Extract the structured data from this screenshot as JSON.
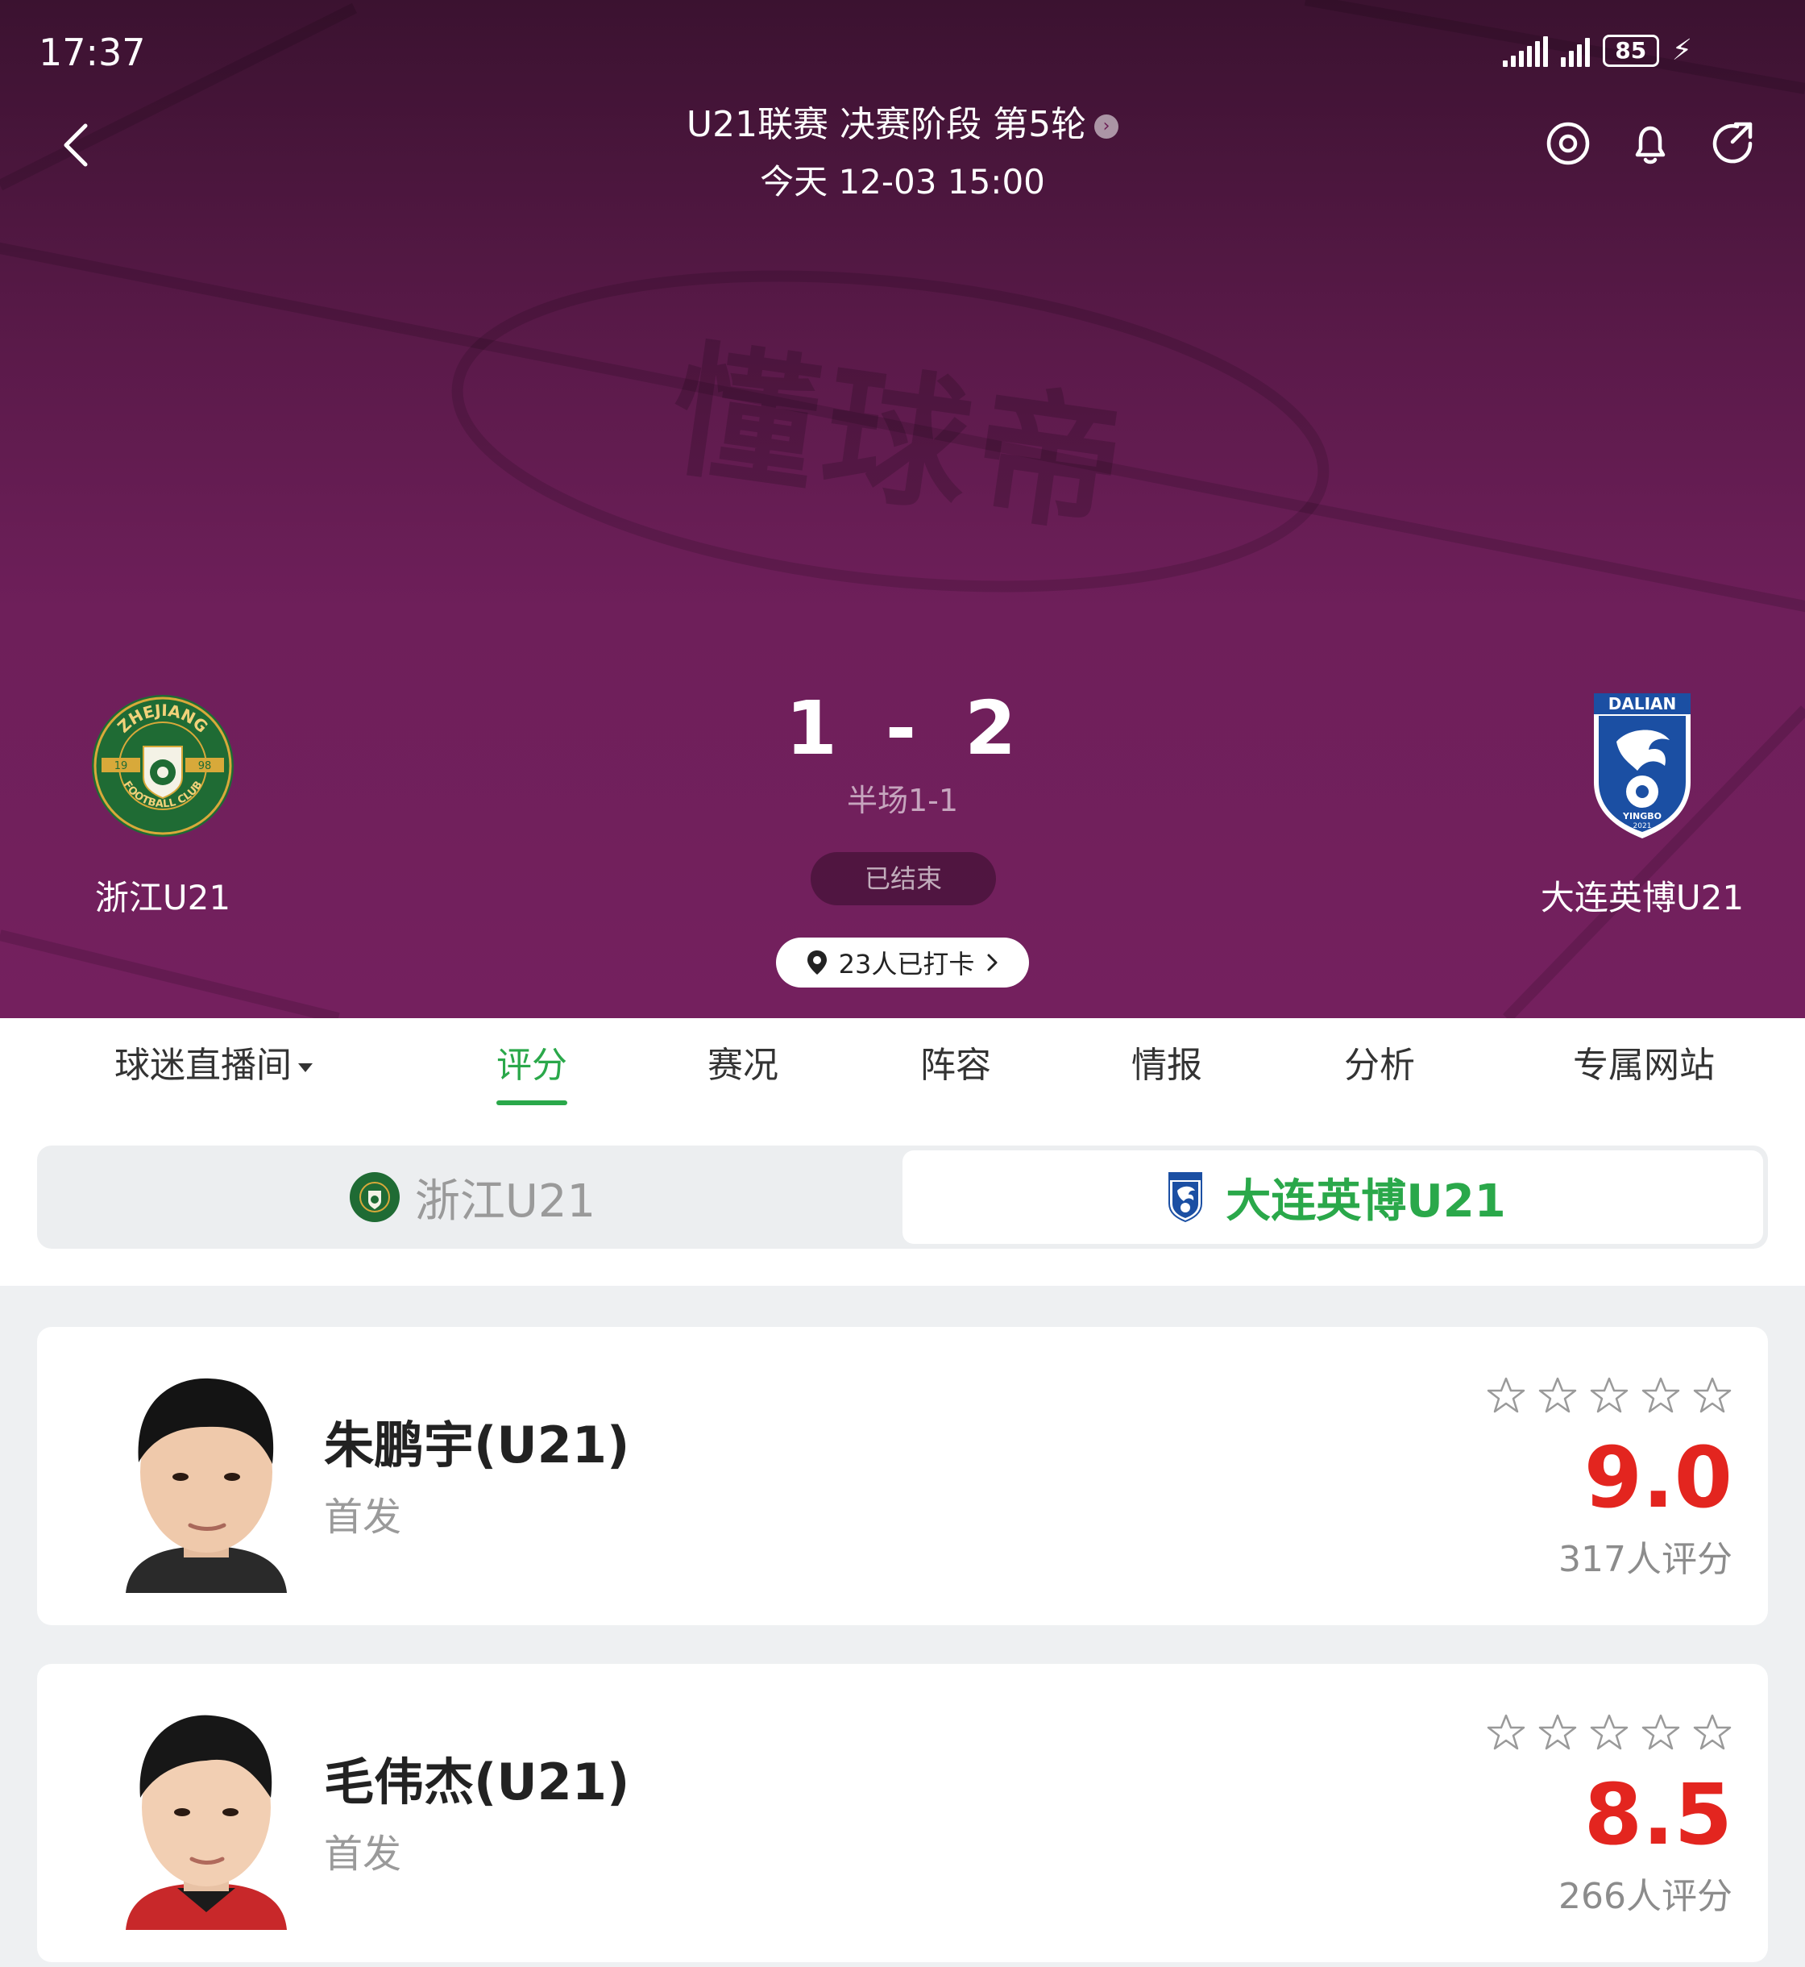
{
  "status_bar": {
    "time": "17:37",
    "battery": "85"
  },
  "header": {
    "title": "U21联赛 决赛阶段 第5轮",
    "datetime": "今天 12-03 15:00"
  },
  "match": {
    "home": {
      "name": "浙江U21",
      "logo_text_top": "ZHEJIANG",
      "logo_left": "19",
      "logo_right": "98",
      "logo_text_bottom": "FOOTBALL CLUB"
    },
    "away": {
      "name": "大连英博U21",
      "logo_text_top": "DALIAN",
      "logo_text_bottom": "YINGBO",
      "logo_year": "2021"
    },
    "home_score": "1",
    "away_score": "2",
    "score_sep": "-",
    "halftime": "半场1-1",
    "status": "已结束",
    "checkin": "23人已打卡"
  },
  "tabs": [
    {
      "label": "球迷直播间"
    },
    {
      "label": "评分"
    },
    {
      "label": "赛况"
    },
    {
      "label": "阵容"
    },
    {
      "label": "情报"
    },
    {
      "label": "分析"
    },
    {
      "label": "专属网站"
    }
  ],
  "active_tab": "评分",
  "team_switch": {
    "left": "浙江U21",
    "right": "大连英博U21",
    "selected": "大连英博U21"
  },
  "players": [
    {
      "name": "朱鹏宇(U21)",
      "role": "首发",
      "rating": "9.0",
      "raters": "317人评分",
      "stars_filled": 0
    },
    {
      "name": "毛伟杰(U21)",
      "role": "首发",
      "rating": "8.5",
      "raters": "266人评分",
      "stars_filled": 0
    }
  ],
  "colors": {
    "accent_green": "#2aa84a",
    "rating_red": "#e3251f",
    "hero_purple": "#6e1f5a",
    "zhejiang_green": "#1f6b34",
    "dalian_blue": "#1b4fa3"
  }
}
